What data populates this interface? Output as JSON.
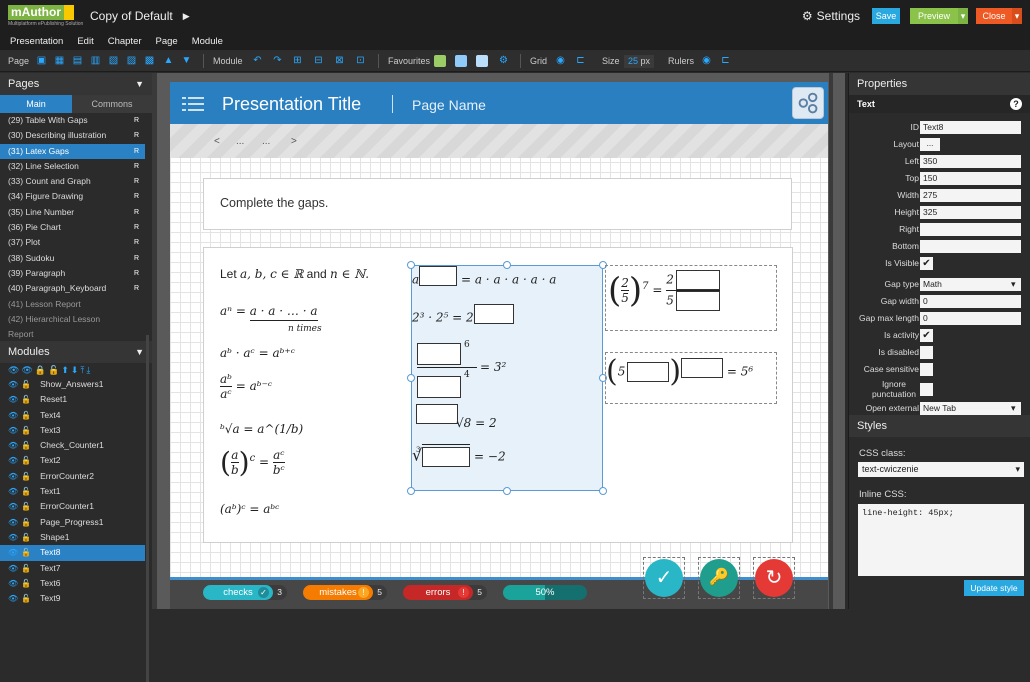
{
  "topbar": {
    "logo_text": "mAuthor",
    "logo_sub": "Multiplatform ePublishing Solution",
    "doc_title": "Copy of Default",
    "settings_label": "Settings",
    "save_label": "Save",
    "preview_label": "Preview",
    "close_label": "Close"
  },
  "menu": [
    "Presentation",
    "Edit",
    "Chapter",
    "Page",
    "Module"
  ],
  "toolbar": {
    "page_label": "Page",
    "module_label": "Module",
    "favourites_label": "Favourites",
    "grid_label": "Grid",
    "size_label": "Size",
    "size_value": "25",
    "size_unit": "px",
    "rulers_label": "Rulers"
  },
  "pages_panel": {
    "title": "Pages",
    "tab_main": "Main",
    "tab_commons": "Commons",
    "items": [
      {
        "label": "(29) Table With Gaps",
        "r": "R"
      },
      {
        "label": "(30) Describing illustration",
        "r": "R"
      },
      {
        "label": "(31) Latex Gaps",
        "r": "R"
      },
      {
        "label": "(32) Line Selection",
        "r": "R"
      },
      {
        "label": "(33) Count and Graph",
        "r": "R"
      },
      {
        "label": "(34) Figure Drawing",
        "r": "R"
      },
      {
        "label": "(35) Line Number",
        "r": "R"
      },
      {
        "label": "(36) Pie Chart",
        "r": "R"
      },
      {
        "label": "(37) Plot",
        "r": "R"
      },
      {
        "label": "(38) Sudoku",
        "r": "R"
      },
      {
        "label": "(39) Paragraph",
        "r": "R"
      },
      {
        "label": "(40) Paragraph_Keyboard",
        "r": "R"
      },
      {
        "label": "(41) Lesson Report",
        "r": ""
      },
      {
        "label": "(42) Hierarchical Lesson",
        "r": ""
      },
      {
        "label": "Report",
        "r": ""
      }
    ]
  },
  "modules_panel": {
    "title": "Modules",
    "items": [
      "Show_Answers1",
      "Reset1",
      "Text4",
      "Text3",
      "Check_Counter1",
      "Text2",
      "ErrorCounter2",
      "Text1",
      "ErrorCounter1",
      "Page_Progress1",
      "Shape1",
      "Text8",
      "Text7",
      "Text6",
      "Text9"
    ]
  },
  "page": {
    "presentation_title": "Presentation Title",
    "page_name": "Page Name",
    "nav_prev": "<",
    "nav_dots1": "...",
    "nav_dots2": "...",
    "nav_next": ">",
    "instruction": "Complete the gaps."
  },
  "math": {
    "intro_prefix": "Let ",
    "intro_vars": "a, b, c ∈ ℝ",
    "intro_and": " and ",
    "intro_n": "n ∈ ℕ.",
    "l1_lhs": "aⁿ = ",
    "l1_rhs": "a · a · … · a",
    "l1_under": "n times",
    "l2": "aᵇ · aᶜ = aᵇ⁺ᶜ",
    "l3_num": "aᵇ",
    "l3_den": "aᶜ",
    "l3_rhs": " = aᵇ⁻ᶜ",
    "l4": "ᵇ√a = a^(1/b)",
    "l5_num": "a",
    "l5_den": "b",
    "l5_exp": "c",
    "l5_rnum": "aᶜ",
    "l5_rden": "bᶜ",
    "l6": "(aᵇ)ᶜ = aᵇᶜ",
    "g1_a": "a",
    "g1_rhs": " = a · a · a · a · a",
    "g2_lhs": "2³ · 2⁵ = 2",
    "g3_exp1": "6",
    "g3_exp2": "4",
    "g3_rhs": " = 3²",
    "g4_rhs": "√8 = 2",
    "g5_idx": "3",
    "g5_rhs": " = −2",
    "g6_num": "2",
    "g6_den": "5",
    "g6_exp": "7",
    "g6_rnum": "2",
    "g6_rden": "5",
    "g7_5": "5",
    "g7_rhs": " = 5⁶"
  },
  "bottom": {
    "checks_label": "checks",
    "checks_count": "3",
    "mistakes_label": "mistakes",
    "mistakes_count": "5",
    "errors_label": "errors",
    "errors_count": "5",
    "progress_label": "50%",
    "progress": 0.5
  },
  "properties": {
    "title": "Properties",
    "section": "Text",
    "rows": [
      {
        "label": "ID",
        "value": "Text8",
        "kind": "text"
      },
      {
        "label": "Layout",
        "value": "...",
        "kind": "button"
      },
      {
        "label": "Left",
        "value": "350",
        "kind": "text"
      },
      {
        "label": "Top",
        "value": "150",
        "kind": "text"
      },
      {
        "label": "Width",
        "value": "275",
        "kind": "text"
      },
      {
        "label": "Height",
        "value": "325",
        "kind": "text"
      },
      {
        "label": "Right",
        "value": "",
        "kind": "text"
      },
      {
        "label": "Bottom",
        "value": "",
        "kind": "text"
      },
      {
        "label": "Is Visible",
        "value": "✔",
        "kind": "check"
      },
      {
        "label": "Gap type",
        "value": "Math",
        "kind": "select"
      },
      {
        "label": "Gap width",
        "value": "0",
        "kind": "text"
      },
      {
        "label": "Gap max length",
        "value": "0",
        "kind": "text"
      },
      {
        "label": "Is activity",
        "value": "✔",
        "kind": "check"
      },
      {
        "label": "Is disabled",
        "value": "",
        "kind": "check"
      },
      {
        "label": "Case sensitive",
        "value": "",
        "kind": "check"
      },
      {
        "label": "Ignore punctuation",
        "value": "",
        "kind": "check"
      },
      {
        "label": "Open external",
        "value": "New Tab",
        "kind": "select"
      }
    ]
  },
  "styles": {
    "title": "Styles",
    "css_class_label": "CSS class:",
    "css_class_value": "text-cwiczenie",
    "inline_label": "Inline CSS:",
    "inline_value": "line-height: 45px;",
    "update_label": "Update style"
  },
  "colors": {
    "accent": "#2a82c4",
    "save": "#2aa8e0",
    "preview": "#8bc34a",
    "close": "#ef5a24",
    "check": "#29b6c6",
    "key": "#1f9e8e",
    "reset": "#e53935"
  }
}
